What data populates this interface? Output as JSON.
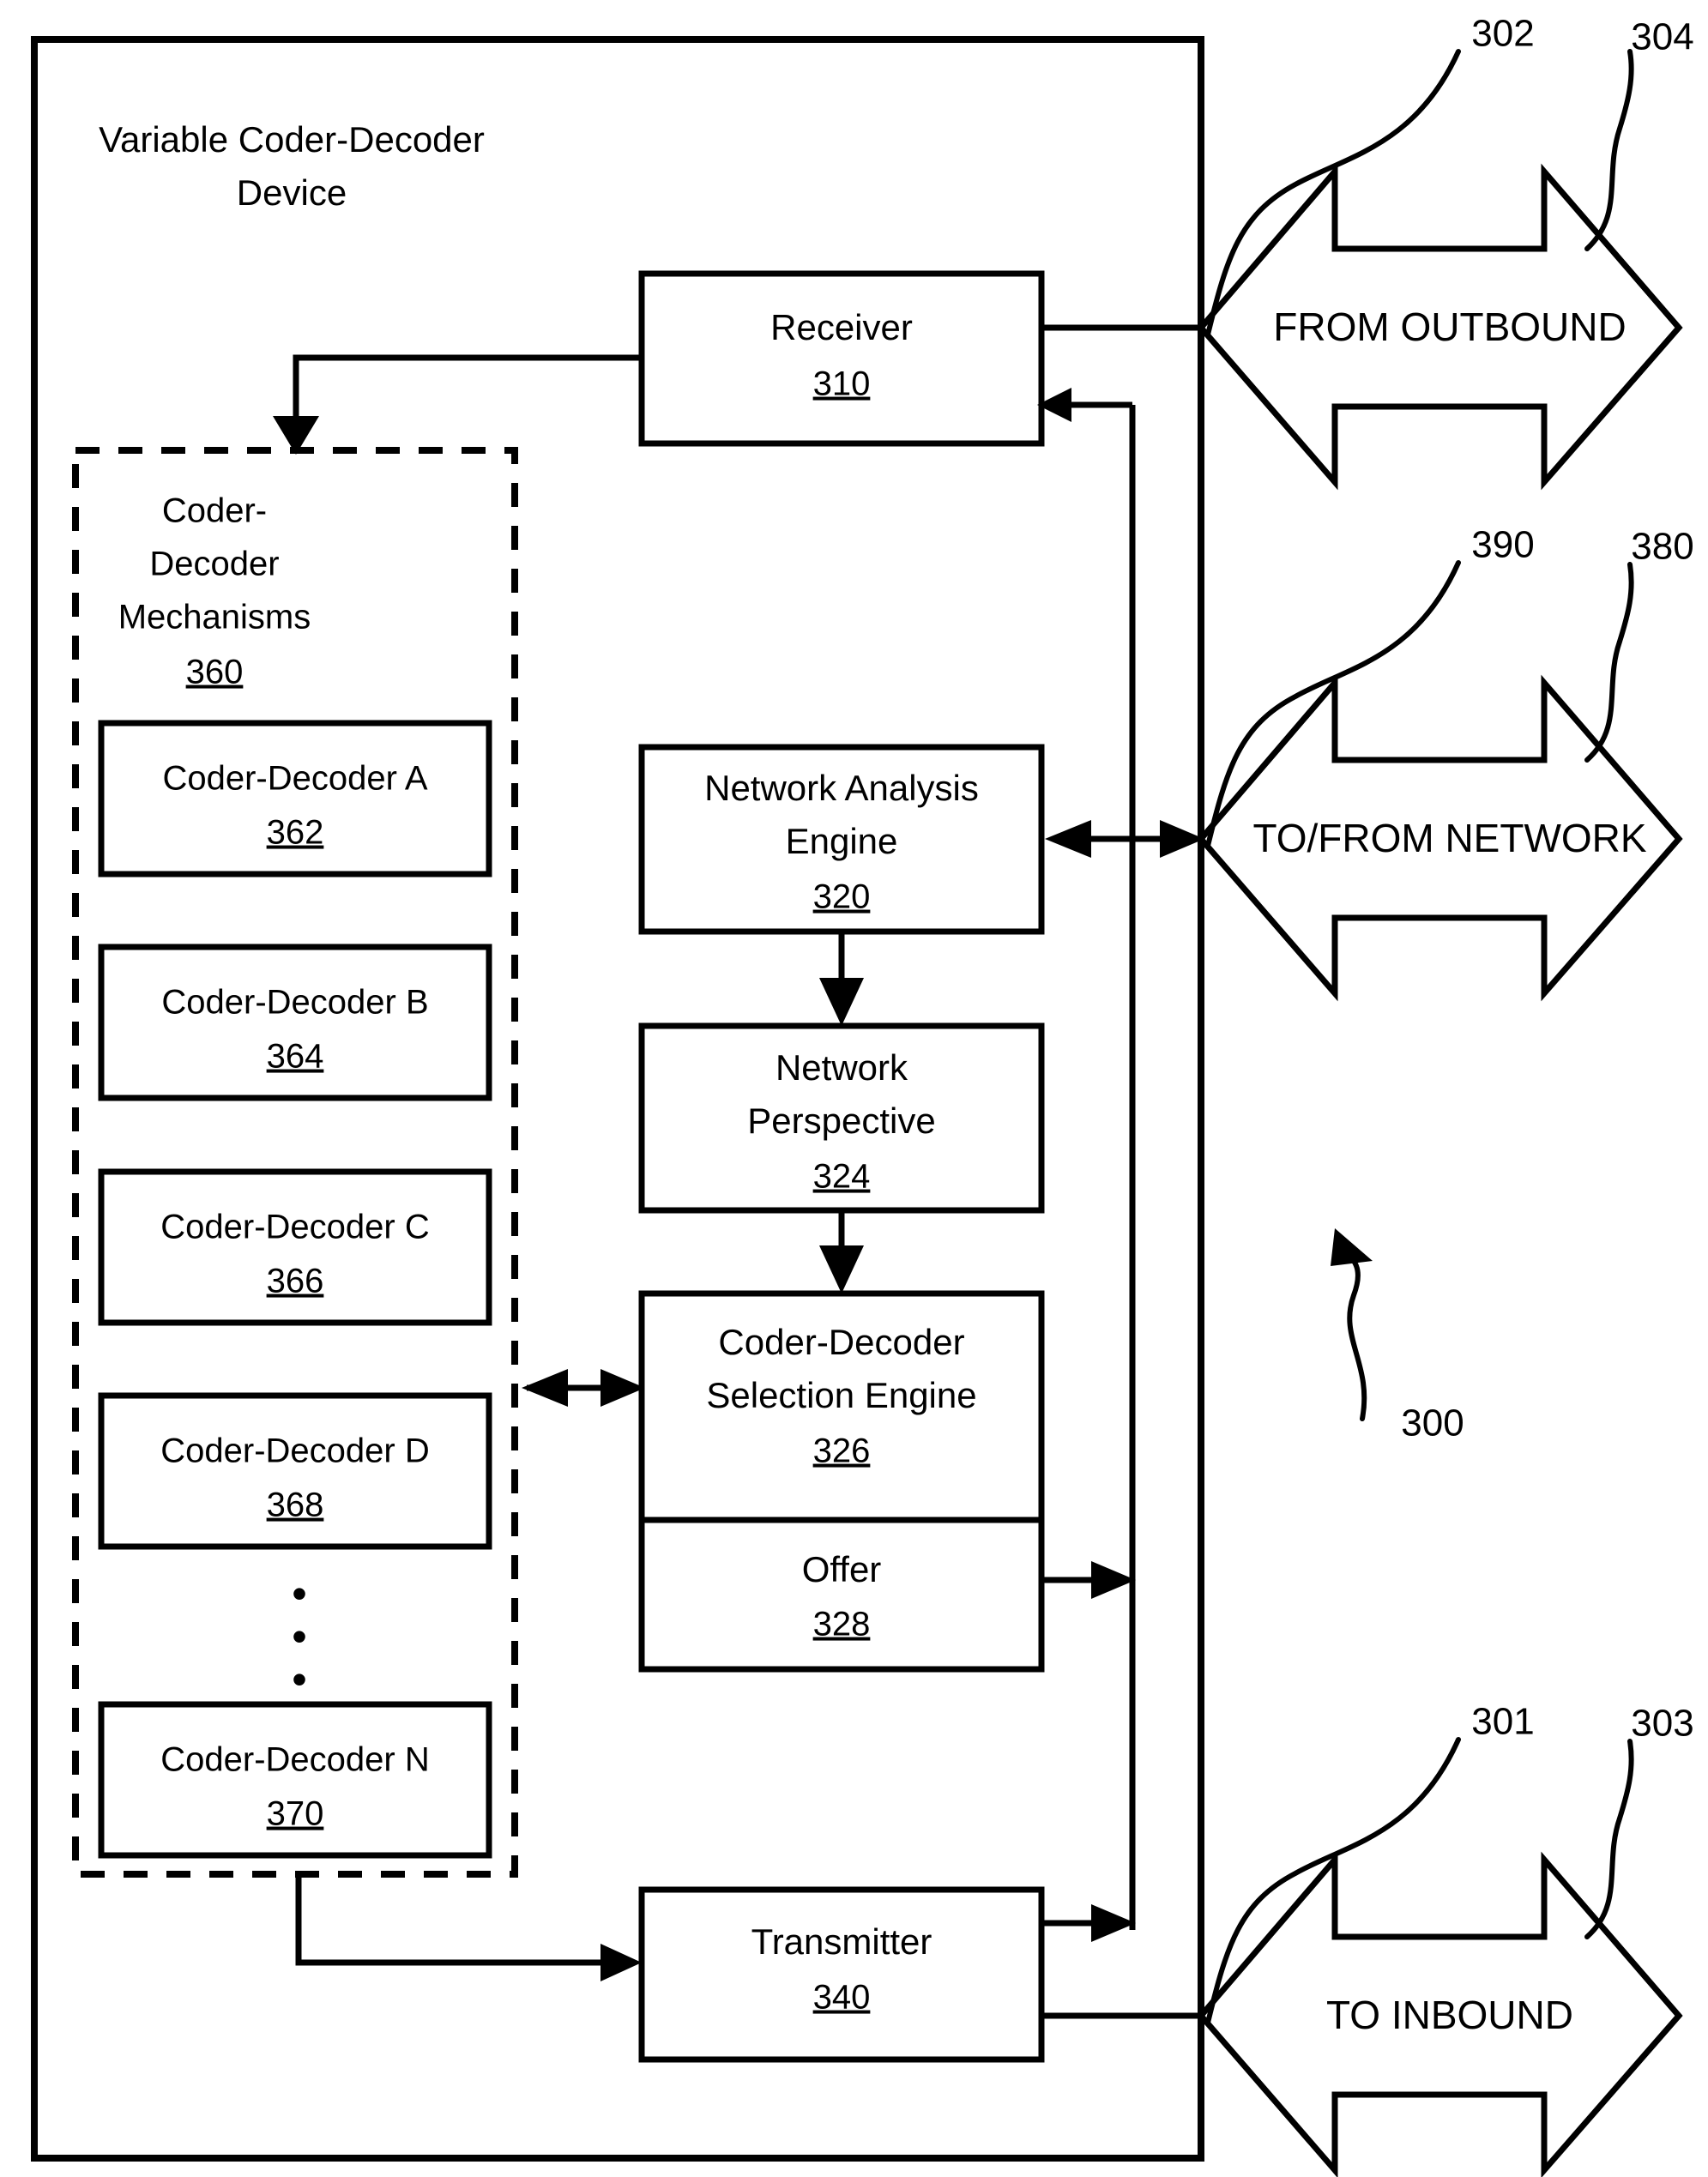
{
  "figure": {
    "device_title_line1": "Variable Coder-Decoder",
    "device_title_line2": "Device",
    "figure_ref": "300"
  },
  "callouts": {
    "from_outbound_lead": "302",
    "from_outbound_body": "304",
    "to_from_network_lead": "390",
    "to_from_network_body": "380",
    "to_inbound_lead": "301",
    "to_inbound_body": "303",
    "device_ref": "300"
  },
  "external_arrows": [
    {
      "name": "from-outbound",
      "label": "FROM OUTBOUND",
      "lead_ref": "302",
      "body_ref": "304"
    },
    {
      "name": "to-from-network",
      "label": "TO/FROM NETWORK",
      "lead_ref": "390",
      "body_ref": "380"
    },
    {
      "name": "to-inbound",
      "label": "TO INBOUND",
      "lead_ref": "301",
      "body_ref": "303"
    }
  ],
  "blocks": {
    "receiver": {
      "label": "Receiver",
      "ref": "310"
    },
    "network_analysis": {
      "label_line1": "Network Analysis",
      "label_line2": "Engine",
      "ref": "320"
    },
    "network_perspective": {
      "label_line1": "Network",
      "label_line2": "Perspective",
      "ref": "324"
    },
    "selection_engine": {
      "label_line1": "Coder-Decoder",
      "label_line2": "Selection Engine",
      "ref": "326"
    },
    "offer": {
      "label": "Offer",
      "ref": "328"
    },
    "transmitter": {
      "label": "Transmitter",
      "ref": "340"
    }
  },
  "codec_group": {
    "title_line1": "Coder-",
    "title_line2": "Decoder",
    "title_line3": "Mechanisms",
    "ref": "360",
    "ellipsis": "•",
    "items": [
      {
        "label": "Coder-Decoder A",
        "ref": "362"
      },
      {
        "label": "Coder-Decoder B",
        "ref": "364"
      },
      {
        "label": "Coder-Decoder C",
        "ref": "366"
      },
      {
        "label": "Coder-Decoder D",
        "ref": "368"
      },
      {
        "label": "Coder-Decoder N",
        "ref": "370"
      }
    ]
  },
  "colors": {
    "ink": "#000000",
    "paper": "#ffffff"
  }
}
